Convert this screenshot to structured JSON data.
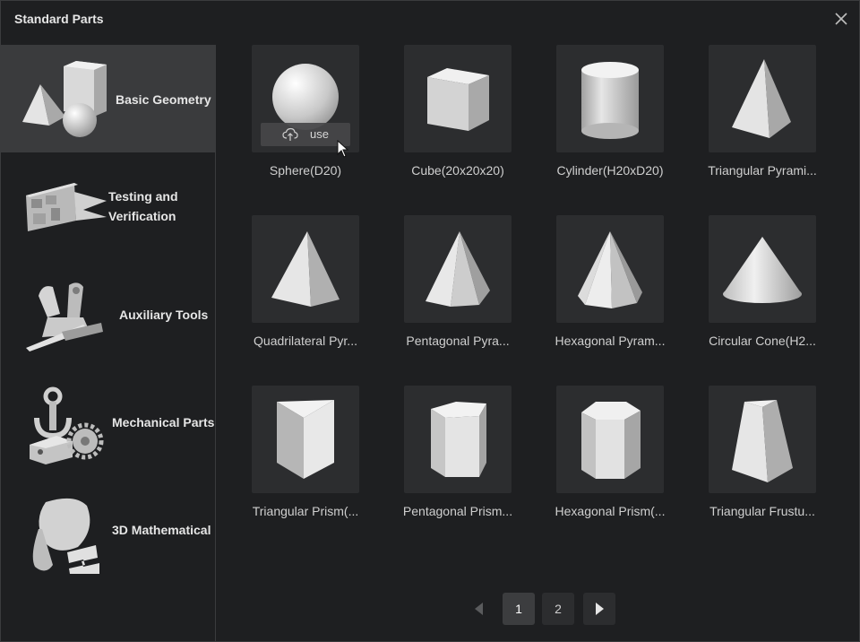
{
  "dialog": {
    "title": "Standard Parts",
    "close_icon": "close-icon"
  },
  "sidebar": {
    "items": [
      {
        "label": "Basic Geometry",
        "active": true
      },
      {
        "label_line1": "Testing and",
        "label_line2": "Verification"
      },
      {
        "label": "Auxiliary Tools"
      },
      {
        "label": "Mechanical Parts"
      },
      {
        "label": "3D Mathematical"
      }
    ]
  },
  "parts": [
    {
      "name": "Sphere(D20)",
      "icon": "sphere-icon"
    },
    {
      "name": "Cube(20x20x20)",
      "icon": "cube-icon"
    },
    {
      "name": "Cylinder(H20xD20)",
      "icon": "cylinder-icon"
    },
    {
      "name": "Triangular Pyrami...",
      "icon": "triangular-pyramid-icon"
    },
    {
      "name": "Quadrilateral Pyr...",
      "icon": "quadrilateral-pyramid-icon"
    },
    {
      "name": "Pentagonal Pyra...",
      "icon": "pentagonal-pyramid-icon"
    },
    {
      "name": "Hexagonal Pyram...",
      "icon": "hexagonal-pyramid-icon"
    },
    {
      "name": "Circular Cone(H2...",
      "icon": "cone-icon"
    },
    {
      "name": "Triangular Prism(...",
      "icon": "triangular-prism-icon"
    },
    {
      "name": "Pentagonal Prism...",
      "icon": "pentagonal-prism-icon"
    },
    {
      "name": "Hexagonal Prism(...",
      "icon": "hexagonal-prism-icon"
    },
    {
      "name": "Triangular Frustu...",
      "icon": "triangular-frustum-icon"
    }
  ],
  "use_button": {
    "label": "use",
    "icon": "cloud-upload-icon"
  },
  "pagination": {
    "pages": [
      "1",
      "2"
    ],
    "current": "1"
  }
}
